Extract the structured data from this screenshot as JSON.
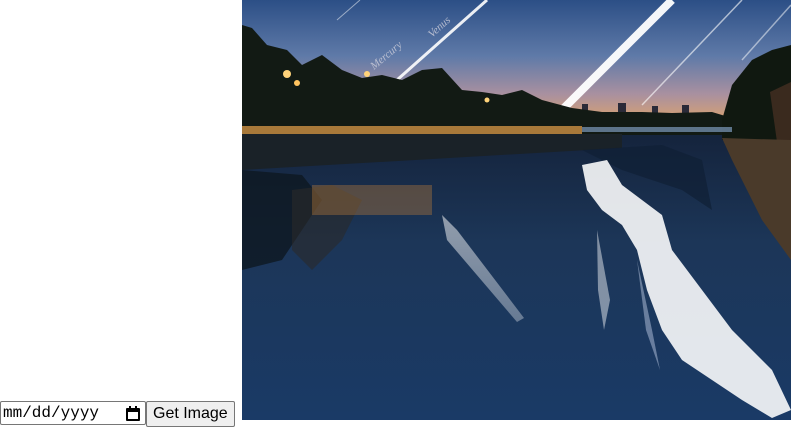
{
  "form": {
    "date_placeholder": "mm/dd/yyyy",
    "date_value": "",
    "submit_label": "Get Image"
  },
  "image": {
    "labels": {
      "mercury": "Mercury",
      "venus": "Venus"
    }
  },
  "icons": {
    "calendar": "calendar-icon"
  }
}
